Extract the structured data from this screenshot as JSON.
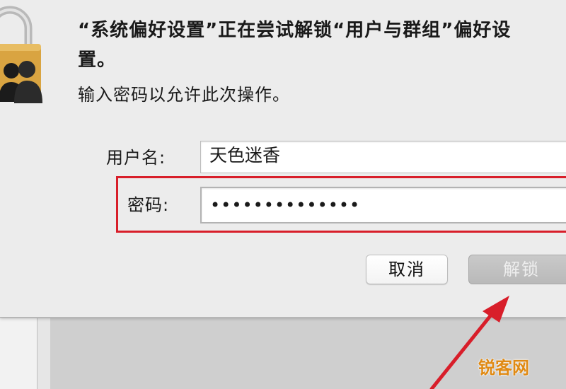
{
  "dialog": {
    "title": "“系统偏好设置”正在尝试解锁“用户与群组”偏好设置。",
    "subtitle": "输入密码以允许此次操作。",
    "username_label": "用户名:",
    "username_value": "天色迷香",
    "password_label": "密码:",
    "password_value": "••••••••••••••",
    "cancel_label": "取消",
    "unlock_label": "解锁",
    "icon": "lock-users-icon"
  },
  "annotation": {
    "highlight_color": "#d81e2a",
    "arrow_target": "unlock-button"
  },
  "watermark": {
    "text": "锐客网",
    "color": "#e08a14"
  }
}
